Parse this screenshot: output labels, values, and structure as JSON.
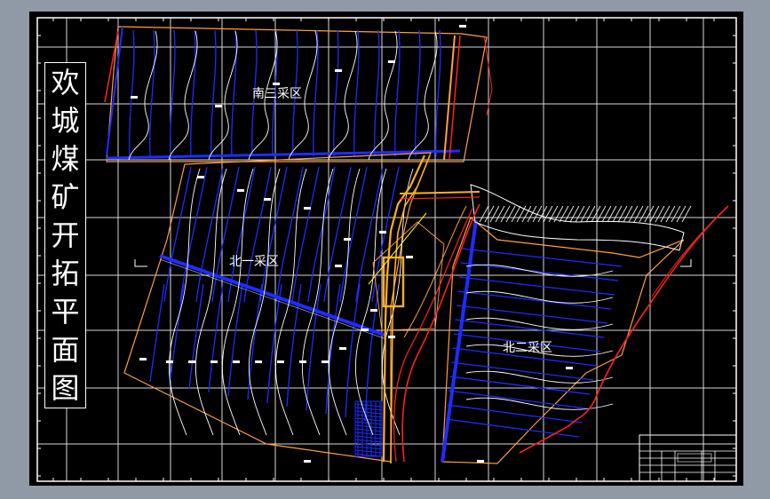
{
  "drawing": {
    "title_chars": [
      "欢",
      "城",
      "煤",
      "矿",
      "开",
      "拓",
      "平",
      "面",
      "图"
    ],
    "zones": {
      "south3": "南三采区",
      "north1": "北一采区",
      "north2": "北二采区"
    }
  },
  "colors": {
    "viewport_gray": "#8f9aa6",
    "canvas": "#000000",
    "grid": "#ffffff",
    "boundary": "#ffa040",
    "blue_lines": "#1f2cff",
    "contours": "#ffffff",
    "red_lines": "#ff2020",
    "shaft_orange": "#ffb020",
    "yellow_line": "#ffff00"
  }
}
